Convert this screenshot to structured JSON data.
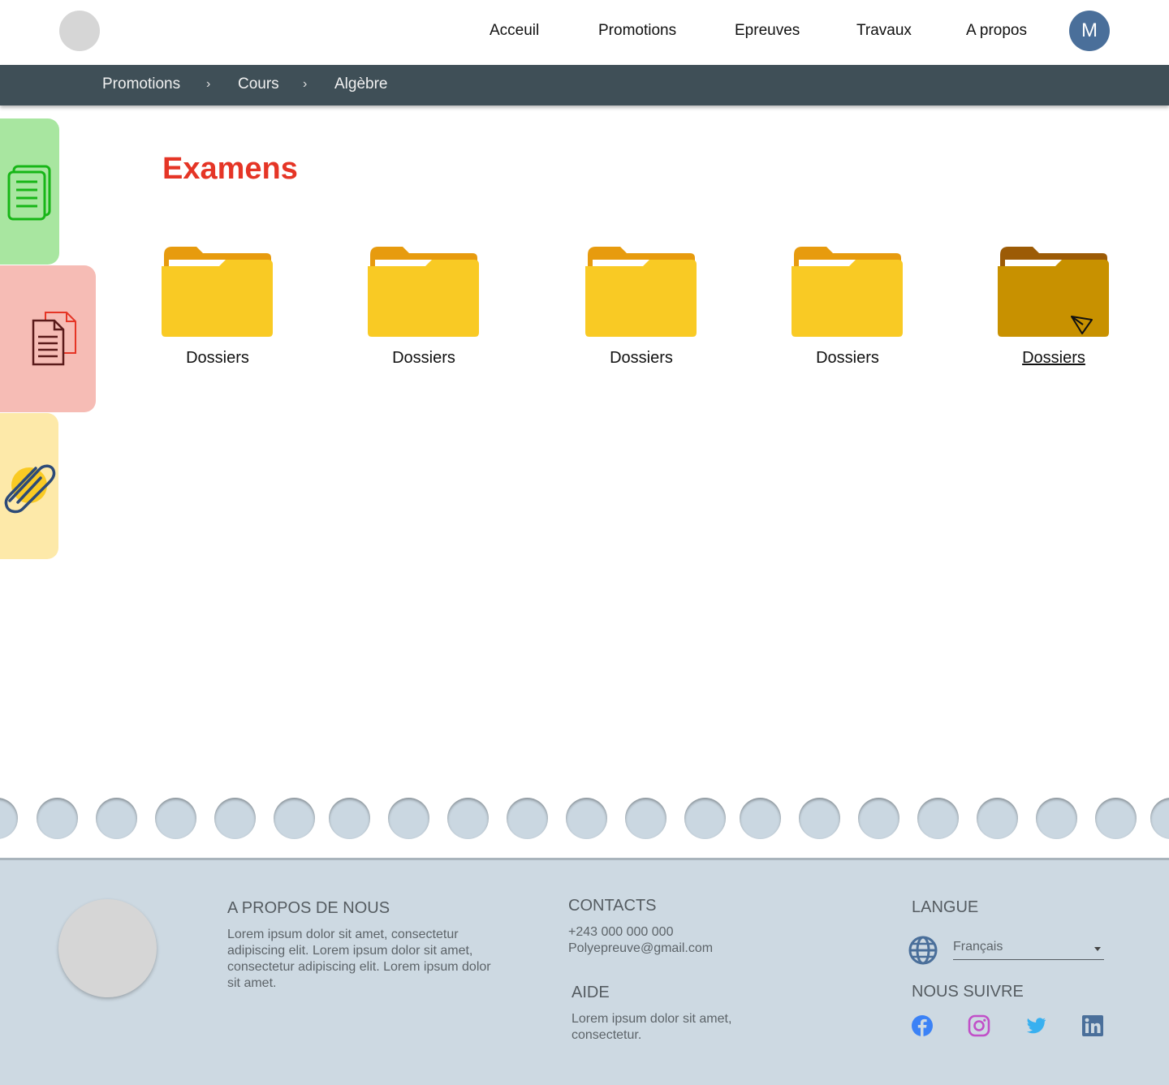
{
  "nav": {
    "items": [
      "Acceuil",
      "Promotions",
      "Epreuves",
      "Travaux",
      "A propos"
    ],
    "avatar_initial": "M"
  },
  "breadcrumb": [
    "Promotions",
    "Cours",
    "Algèbre"
  ],
  "page_title": "Examens",
  "folders": [
    {
      "label": "Dossiers",
      "state": "normal"
    },
    {
      "label": "Dossiers",
      "state": "normal"
    },
    {
      "label": "Dossiers",
      "state": "normal"
    },
    {
      "label": "Dossiers",
      "state": "normal"
    },
    {
      "label": "Dossiers",
      "state": "hover"
    }
  ],
  "side_tabs": [
    {
      "icon": "documents-icon",
      "color": "#a8e6a0"
    },
    {
      "icon": "pdf-document-icon",
      "color": "#f6bcb5"
    },
    {
      "icon": "paperclip-icon",
      "color": "#fde9a9"
    }
  ],
  "footer": {
    "about_title": "A PROPOS DE NOUS",
    "about_text": "Lorem ipsum dolor sit amet, consectetur adipiscing elit. Lorem ipsum dolor sit amet, consectetur adipiscing elit. Lorem ipsum dolor sit amet.",
    "contacts_title": "CONTACTS",
    "phone": "+243 000 000 000",
    "email": "Polyepreuve@gmail.com",
    "help_title": "AIDE",
    "help_text": "Lorem ipsum dolor sit amet, consectetur.",
    "language_title": "LANGUE",
    "language_value": "Français",
    "follow_title": "NOUS SUIVRE",
    "socials": [
      "facebook-icon",
      "instagram-icon",
      "twitter-icon",
      "linkedin-icon"
    ]
  },
  "colors": {
    "title": "#e53526",
    "crumbbar": "#3f4f57",
    "footer_bg": "#cdd9e2",
    "folder": "#f9ca24",
    "folder_hover": "#c89100"
  }
}
